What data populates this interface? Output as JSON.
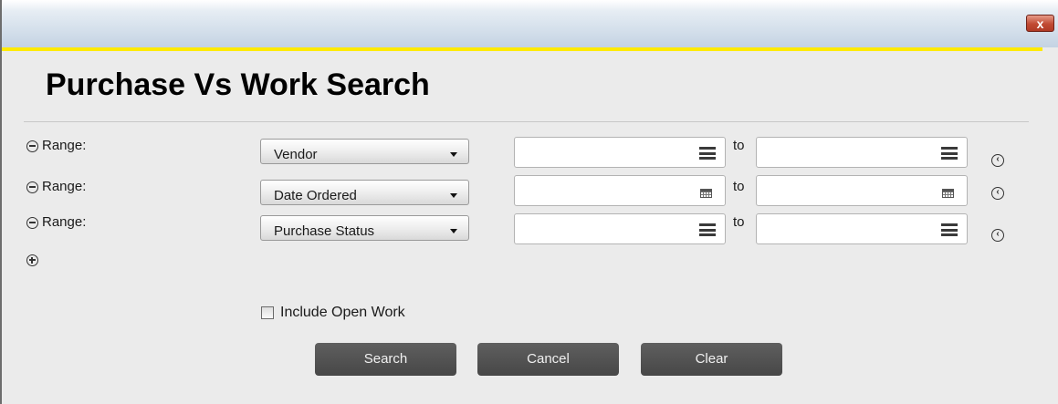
{
  "window": {
    "close_glyph": "x",
    "close_label": "Close"
  },
  "dialog": {
    "title": "Purchase Vs Work Search"
  },
  "ranges": [
    {
      "label": "Range:",
      "field": "Vendor",
      "from_value": "",
      "to_label": "to",
      "to_value": "",
      "picker": "list"
    },
    {
      "label": "Range:",
      "field": "Date Ordered",
      "from_value": "",
      "to_label": "to",
      "to_value": "",
      "picker": "calendar"
    },
    {
      "label": "Range:",
      "field": "Purchase Status",
      "from_value": "",
      "to_label": "to",
      "to_value": "",
      "picker": "list"
    }
  ],
  "options": {
    "include_open_work_label": "Include Open Work",
    "include_open_work_checked": false
  },
  "buttons": {
    "search": "Search",
    "cancel": "Cancel",
    "clear": "Clear"
  },
  "colors": {
    "accent_line": "#ffea00",
    "button_bg": "#535353",
    "close_button": "#c14a33"
  }
}
